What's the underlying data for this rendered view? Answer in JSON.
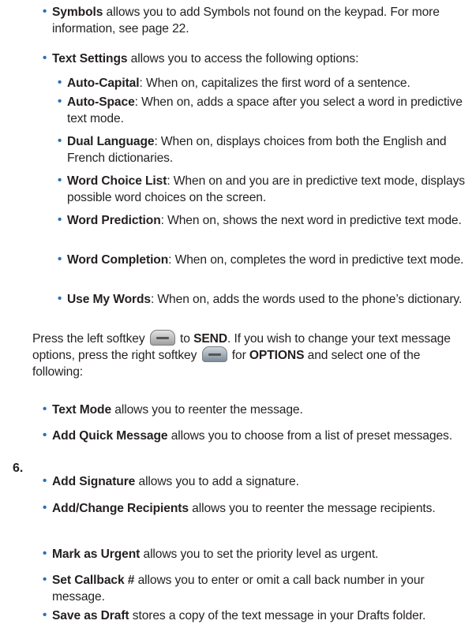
{
  "symbols": {
    "term": "Symbols",
    "text": " allows you to add Symbols not found on the keypad. For more information, see page 22."
  },
  "text_settings": {
    "term": "Text Settings",
    "text": " allows you to access the following options:"
  },
  "options": [
    {
      "term": "Auto-Capital",
      "text": ": When on, capitalizes the first word of a sentence."
    },
    {
      "term": "Auto-Space",
      "text": ": When on, adds a space after you select a word in predictive text mode."
    },
    {
      "term": "Dual Language",
      "text": ": When on, displays choices from both the English and French dictionaries."
    },
    {
      "term": "Word Choice List",
      "text": ": When on and you are in predictive text mode, displays possible word choices on the screen."
    },
    {
      "term": "Word Prediction",
      "text": ": When on, shows the next word in predictive text mode."
    },
    {
      "term": "Word Completion",
      "text": ": When on, completes the word in predictive text mode."
    },
    {
      "term": "Use My Words",
      "text": ": When on, adds the words used to the phone’s dictionary."
    }
  ],
  "step6": {
    "number": "6.",
    "part1": "Press the left softkey ",
    "key1": "SEND",
    "part2": " to ",
    "part3": ". If you wish to change your text message options, press the right softkey ",
    "key2": "OPTIONS",
    "part4": " for ",
    "part5": " and select one of the following:"
  },
  "msg_options": [
    {
      "term": "Text Mode",
      "text": " allows you to reenter the message."
    },
    {
      "term": "Add Quick Message",
      "text": " allows you to choose from a list of preset messages."
    },
    {
      "term": "Add Signature",
      "text": " allows you to add a signature."
    },
    {
      "term": "Add/Change Recipients",
      "text": " allows you to reenter the message recipients."
    },
    {
      "term": "Mark as Urgent",
      "text": " allows you to set the priority level as urgent."
    },
    {
      "term": "Set Callback #",
      "text": " allows you to enter or omit a call back number in your message."
    },
    {
      "term": "Save as Draft",
      "text": " stores a copy of the text message in your Drafts folder."
    }
  ],
  "bullet_char": "•",
  "colors": {
    "bullet": "#2a6fb5",
    "text": "#231f20"
  }
}
